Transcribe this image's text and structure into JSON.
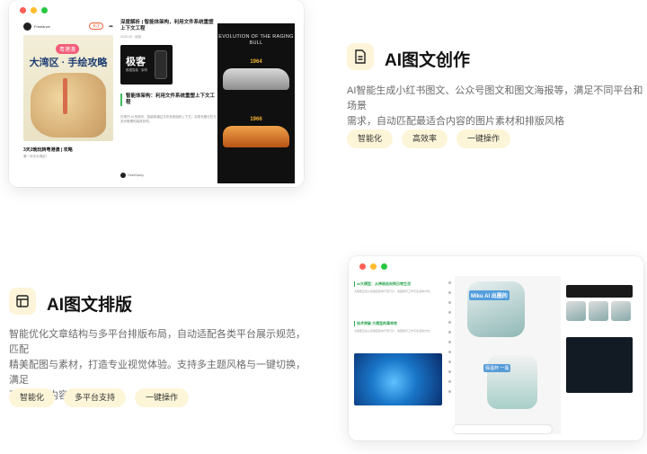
{
  "feature_create": {
    "title": "AI图文创作",
    "icon": "document-icon",
    "desc_line1": "AI智能生成小红书图文、公众号图文和图文海报等，满足不同平台和场景",
    "desc_line2": "需求，自动匹配最适合内容的图片素材和排版风格",
    "tags": [
      "智能化",
      "高效率",
      "一键操作"
    ]
  },
  "feature_layout": {
    "title": "AI图文排版",
    "icon": "layout-icon",
    "desc_line1": "智能优化文章结构与多平台排版布局，自动适配各类平台展示规范，匹配",
    "desc_line2": "精美配图与素材，打造专业视觉体验。支持多主题风格与一键切换，满足",
    "desc_line3": "不同平台内容发布需求",
    "tags": [
      "智能化",
      "多平台支持",
      "一键操作"
    ]
  },
  "preview1": {
    "post_user": "Freelance",
    "follow_label": "关注",
    "poster_tag": "粤港澳",
    "poster_title": "大湾区 · 手绘攻略",
    "post_title": "3天2晚玩转粤港澳 | 攻略",
    "post_sub": "第一次去大湾区？",
    "article_title": "深度解析 | 智能体架构，利用文件系统重塑上下文工程",
    "article_meta": "2025-05 · 阅读",
    "brand_text": "极客",
    "brand_sub": "数据智能 · 架构",
    "highlight": "智能体架构：利用文件系统重塑上下文工程",
    "body_text": "在现代 AI 系统中，智能体通过文件系统组织上下文，实现长期记忆与多步推理的高效协同。",
    "author": "GeekSavvy",
    "cars_title": "EVOLUTION OF THE RAGING BULL",
    "year1": "1964",
    "year2": "1966"
  },
  "preview2": {
    "heading1": "AI大模型：从神秘走向到日常生活",
    "heading2": "技术突破 大模型的革命性",
    "body_text": "大模型正在从实验室走向千家万户，改变我们工作与生活的方式。",
    "cup_label1": "Miku AI 出圈的",
    "cup_label2": "保温杯 一瓶"
  }
}
